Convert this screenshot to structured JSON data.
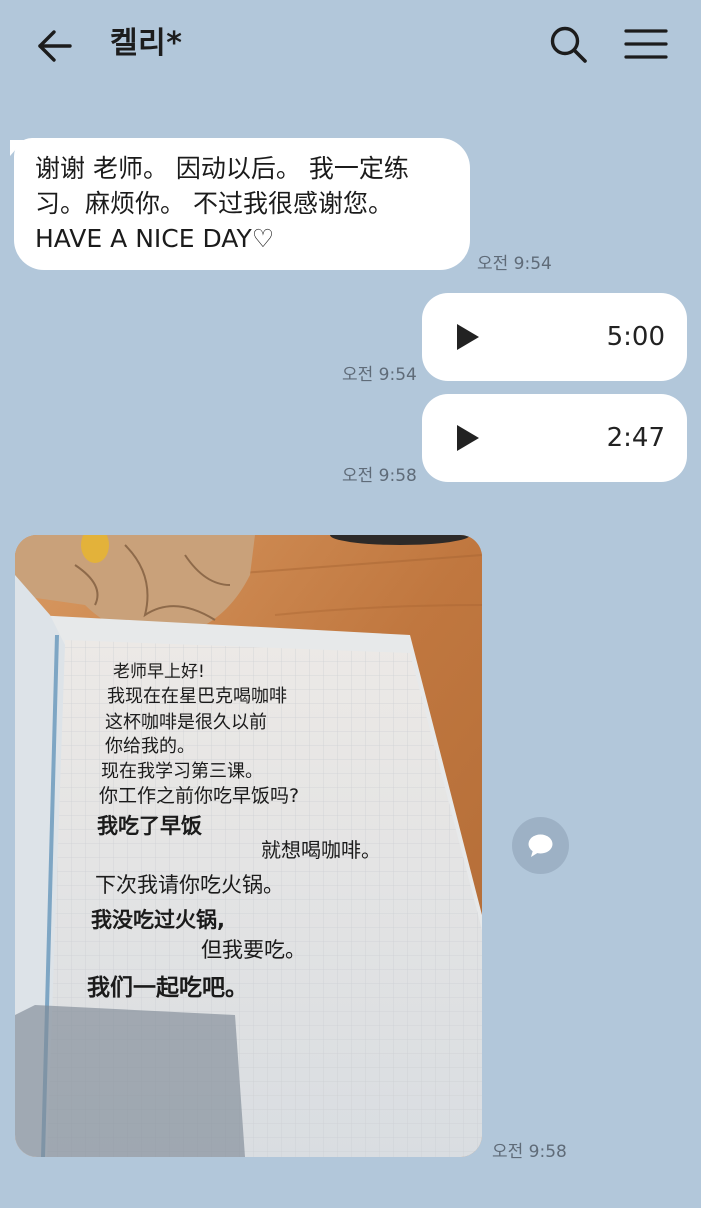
{
  "header": {
    "title": "켈리*",
    "back_icon": "arrow-left-icon",
    "search_icon": "search-icon",
    "menu_icon": "hamburger-menu-icon"
  },
  "messages": [
    {
      "type": "text",
      "direction": "incoming",
      "text": "谢谢 老师。 因动以后。 我一定练\n习。麻烦你。 不过我很感谢您。\nHAVE A NICE DAY♡",
      "time": "오전 9:54"
    },
    {
      "type": "voice",
      "direction": "outgoing",
      "duration": "5:00",
      "time": "오전 9:54"
    },
    {
      "type": "voice",
      "direction": "outgoing",
      "duration": "2:47",
      "time": "오전 9:58"
    },
    {
      "type": "image",
      "direction": "incoming",
      "time": "오전 9:58",
      "handwritten_lines": [
        "老师早上好!",
        "我现在在星巴克喝咖啡",
        "这杯咖啡是很久以前",
        "你给我的。",
        "现在我学习第三课。",
        "你工作之前你吃早饭吗?",
        "我吃了早饭",
        "就想喝咖啡。",
        "下次我请你吃火锅。",
        "我没吃过火锅,",
        "但我要吃。",
        "我们一起吃吧。"
      ]
    }
  ],
  "colors": {
    "background": "#b2c7da",
    "bubble": "#ffffff",
    "timestamp": "#5f6b78",
    "share_button": "#9db1c5"
  }
}
